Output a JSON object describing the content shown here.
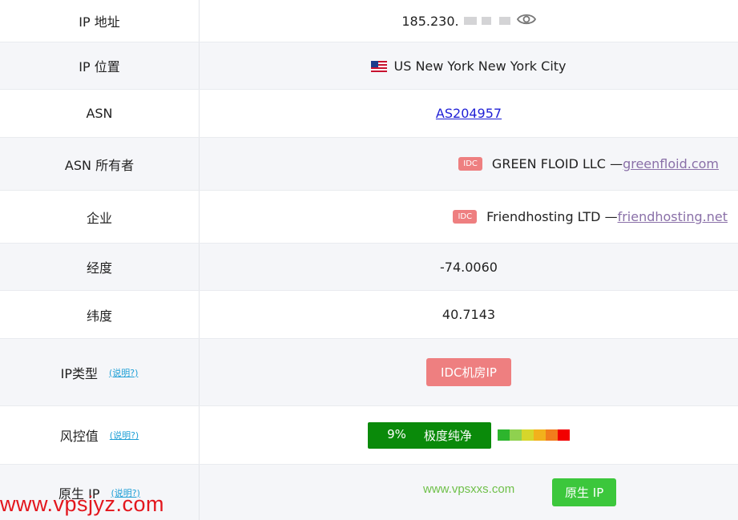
{
  "rows": {
    "ip_address": {
      "label": "IP 地址",
      "value": "185.230."
    },
    "ip_location": {
      "label": "IP 位置",
      "flag": "us-flag",
      "value": "US New York New York City"
    },
    "asn": {
      "label": "ASN",
      "value": "AS204957"
    },
    "asn_owner": {
      "label": "ASN 所有者",
      "badge": "IDC",
      "name": "GREEN FLOID LLC —",
      "link": "greenfloid.com"
    },
    "company": {
      "label": "企业",
      "badge": "IDC",
      "name": "Friendhosting LTD —",
      "link": "friendhosting.net"
    },
    "longitude": {
      "label": "经度",
      "value": "-74.0060"
    },
    "latitude": {
      "label": "纬度",
      "value": "40.7143"
    },
    "ip_type": {
      "label": "IP类型",
      "explain": "(说明?)",
      "value": "IDC机房IP"
    },
    "risk": {
      "label": "风控值",
      "explain": "(说明?)",
      "percent": "9%",
      "text": "极度纯净",
      "scale_colors": [
        "#2db52d",
        "#8fd14f",
        "#d6d62b",
        "#f2b11c",
        "#f27d1c",
        "#f20000"
      ]
    },
    "native_ip": {
      "label": "原生 IP",
      "explain": "(说明?)",
      "value": "原生 IP"
    }
  },
  "watermarks": {
    "primary": "www.vpsjyz.com",
    "secondary": "www.vpsxxs.com"
  },
  "colors": {
    "badge_red": "#ee7f80",
    "risk_green": "#0a8a0a",
    "native_green": "#3cc73c",
    "link_blue": "#1f1fd6",
    "link_purple": "#8a70a8",
    "explain_blue": "#1e9fd6"
  }
}
